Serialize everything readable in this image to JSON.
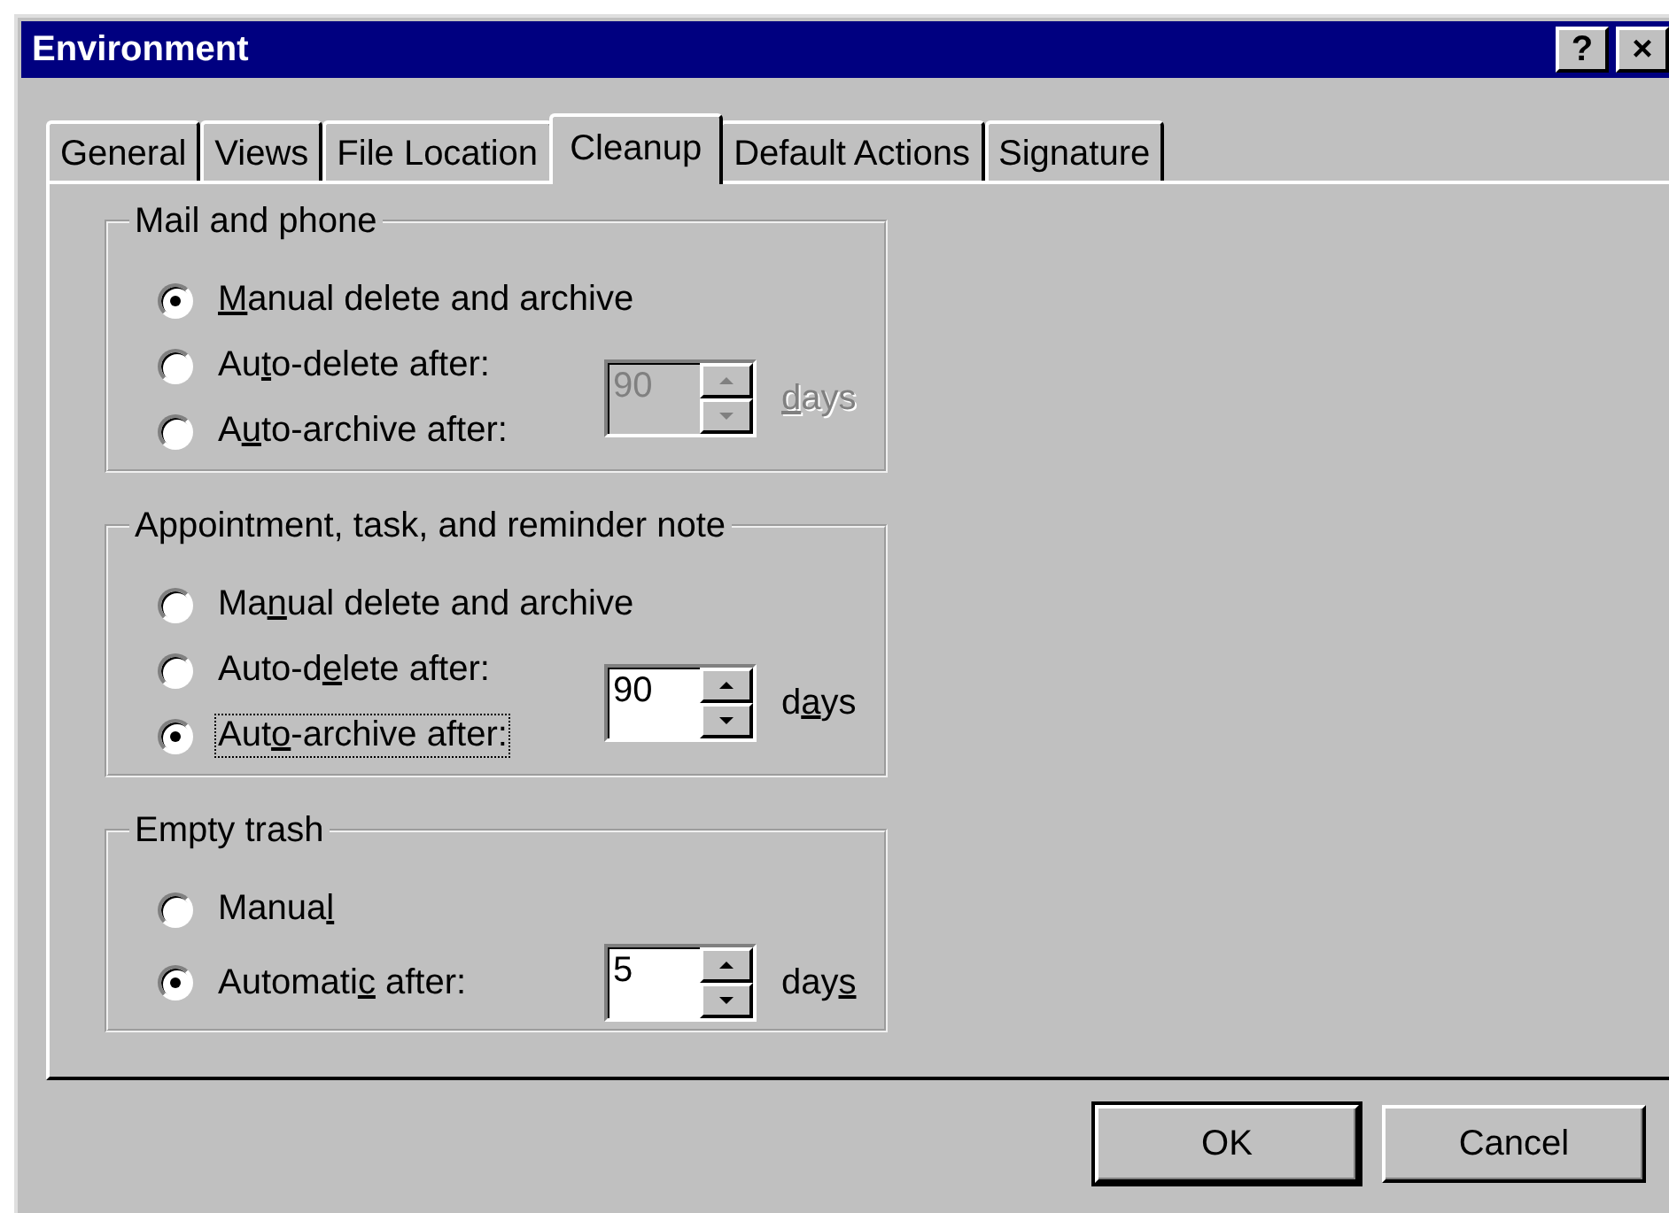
{
  "window": {
    "title": "Environment",
    "title_buttons": [
      "?",
      "×"
    ]
  },
  "tabs": [
    {
      "label": "General",
      "selected": false
    },
    {
      "label": "Views",
      "selected": false
    },
    {
      "label": "File Location",
      "selected": false
    },
    {
      "label": "Cleanup",
      "selected": true
    },
    {
      "label": "Default Actions",
      "selected": false
    },
    {
      "label": "Signature",
      "selected": false
    }
  ],
  "groups": [
    {
      "title": "Mail and phone",
      "options": [
        {
          "access_key": "M",
          "after_key": "anual delete and archive",
          "selected": true,
          "focused": false
        },
        {
          "before_key": "Au",
          "access_key": "t",
          "after_key": "o-delete after:",
          "selected": false,
          "focused": false
        },
        {
          "before_key": "A",
          "access_key": "u",
          "after_key": "to-archive after:",
          "selected": false,
          "focused": false
        }
      ],
      "spinner": {
        "value": "90",
        "disabled": true
      },
      "unit": {
        "access_key": "d",
        "after_key": "ays"
      }
    },
    {
      "title": "Appointment, task, and reminder note",
      "options": [
        {
          "before_key": "Ma",
          "access_key": "n",
          "after_key": "ual delete and archive",
          "selected": false,
          "focused": false
        },
        {
          "before_key": "Auto-d",
          "access_key": "e",
          "after_key": "lete after:",
          "selected": false,
          "focused": false
        },
        {
          "before_key": "Aut",
          "access_key": "o",
          "after_key": "-archive after:",
          "selected": true,
          "focused": true
        }
      ],
      "spinner": {
        "value": "90",
        "disabled": false
      },
      "unit": {
        "before_key": "d",
        "access_key": "a",
        "after_key": "ys"
      }
    },
    {
      "title": "Empty trash",
      "options": [
        {
          "before_key": "Manua",
          "access_key": "l",
          "selected": false,
          "focused": false
        },
        {
          "before_key": "Automati",
          "access_key": "c",
          "after_key": " after:",
          "selected": true,
          "focused": false
        }
      ],
      "spinner": {
        "value": "5",
        "disabled": false
      },
      "unit": {
        "before_key": "day",
        "access_key": "s"
      }
    }
  ],
  "buttons": [
    {
      "label": "OK",
      "default": true
    },
    {
      "label": "Cancel",
      "default": false
    }
  ]
}
